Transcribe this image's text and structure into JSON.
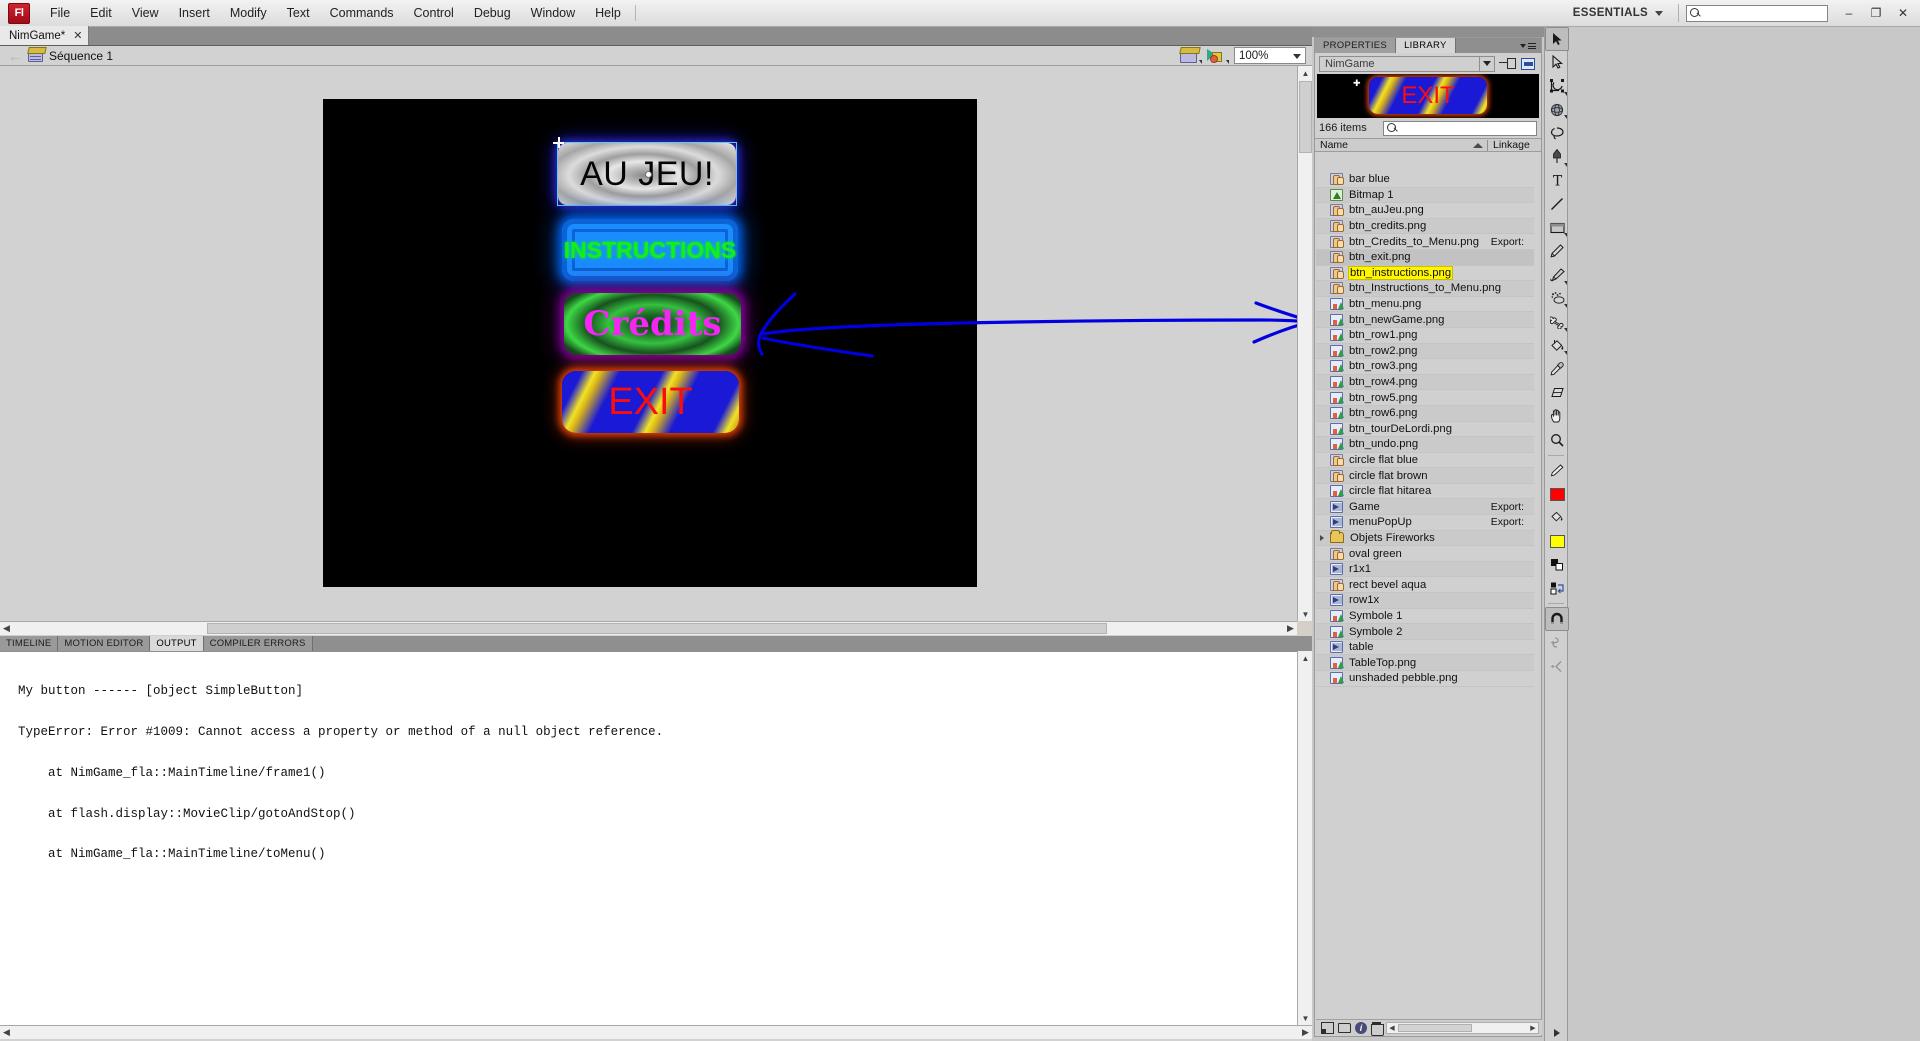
{
  "app": {
    "logo": "Fl",
    "menu": [
      "File",
      "Edit",
      "View",
      "Insert",
      "Modify",
      "Text",
      "Commands",
      "Control",
      "Debug",
      "Window",
      "Help"
    ],
    "workspace": "ESSENTIALS",
    "search_placeholder": "",
    "window_buttons": {
      "minimize": "–",
      "maximize": "❐",
      "close": "✕"
    }
  },
  "document_tab": {
    "title": "NimGame*",
    "close": "✕"
  },
  "edit_bar": {
    "back": "←",
    "scene_name": "Séquence 1",
    "zoom": "100%",
    "edit_scene_icon": "scene-icon",
    "edit_symbols_icon": "symbols-icon"
  },
  "stage": {
    "buttons": [
      {
        "label": "AU JEU!",
        "name": "btn-au-jeu",
        "selected": true
      },
      {
        "label": "INSTRUCTIONS",
        "name": "btn-instructions",
        "selected": false
      },
      {
        "label": "Crédits",
        "name": "btn-credits",
        "selected": false
      },
      {
        "label": "EXIT",
        "name": "btn-exit",
        "selected": false
      }
    ],
    "annotation": {
      "type": "hand-drawn-arrow",
      "color": "#0000e0"
    },
    "selection_color": "#66c8f2"
  },
  "bottom_panel": {
    "tabs": [
      {
        "label": "TIMELINE",
        "active": false
      },
      {
        "label": "MOTION EDITOR",
        "active": false
      },
      {
        "label": "OUTPUT",
        "active": true
      },
      {
        "label": "COMPILER ERRORS",
        "active": false
      }
    ],
    "output_lines": [
      "My button ------ [object SimpleButton]",
      "TypeError: Error #1009: Cannot access a property or method of a null object reference.",
      "    at NimGame_fla::MainTimeline/frame1()",
      "    at flash.display::MovieClip/gotoAndStop()",
      "    at NimGame_fla::MainTimeline/toMenu()"
    ]
  },
  "library": {
    "tabs": [
      {
        "label": "PROPERTIES",
        "active": false
      },
      {
        "label": "LIBRARY",
        "active": true
      }
    ],
    "menu_icon": "panel-menu-icon",
    "document_select": "NimGame",
    "pin_icon": "pin-library-icon",
    "new_library_icon": "new-library-panel-icon",
    "preview_label": "EXIT",
    "item_count": "166 items",
    "search_placeholder": "",
    "columns": {
      "name": "Name",
      "linkage": "Linkage"
    },
    "items": [
      {
        "name": "bar blue",
        "type": "button",
        "linkage": ""
      },
      {
        "name": "Bitmap 1",
        "type": "bitmap",
        "linkage": ""
      },
      {
        "name": "btn_auJeu.png",
        "type": "button",
        "linkage": ""
      },
      {
        "name": "btn_credits.png",
        "type": "button",
        "linkage": ""
      },
      {
        "name": "btn_Credits_to_Menu.png",
        "type": "button",
        "linkage": "Export:"
      },
      {
        "name": "btn_exit.png",
        "type": "button",
        "linkage": "",
        "selected": true
      },
      {
        "name": "btn_instructions.png",
        "type": "button",
        "linkage": "",
        "highlight": true
      },
      {
        "name": "btn_Instructions_to_Menu.png",
        "type": "button",
        "linkage": ""
      },
      {
        "name": "btn_menu.png",
        "type": "graphic",
        "linkage": ""
      },
      {
        "name": "btn_newGame.png",
        "type": "graphic",
        "linkage": ""
      },
      {
        "name": "btn_row1.png",
        "type": "graphic",
        "linkage": ""
      },
      {
        "name": "btn_row2.png",
        "type": "graphic",
        "linkage": ""
      },
      {
        "name": "btn_row3.png",
        "type": "graphic",
        "linkage": ""
      },
      {
        "name": "btn_row4.png",
        "type": "graphic",
        "linkage": ""
      },
      {
        "name": "btn_row5.png",
        "type": "graphic",
        "linkage": ""
      },
      {
        "name": "btn_row6.png",
        "type": "graphic",
        "linkage": ""
      },
      {
        "name": "btn_tourDeLordi.png",
        "type": "graphic",
        "linkage": ""
      },
      {
        "name": "btn_undo.png",
        "type": "graphic",
        "linkage": ""
      },
      {
        "name": "circle flat blue",
        "type": "button",
        "linkage": ""
      },
      {
        "name": "circle flat brown",
        "type": "button",
        "linkage": ""
      },
      {
        "name": "circle flat hitarea",
        "type": "graphic",
        "linkage": ""
      },
      {
        "name": "Game",
        "type": "movie",
        "linkage": "Export:"
      },
      {
        "name": "menuPopUp",
        "type": "movie",
        "linkage": "Export:"
      },
      {
        "name": "Objets Fireworks",
        "type": "folder",
        "linkage": ""
      },
      {
        "name": "oval green",
        "type": "button",
        "linkage": ""
      },
      {
        "name": "r1x1",
        "type": "movie",
        "linkage": ""
      },
      {
        "name": "rect bevel aqua",
        "type": "button",
        "linkage": ""
      },
      {
        "name": "row1x",
        "type": "movie",
        "linkage": ""
      },
      {
        "name": "Symbole 1",
        "type": "graphic",
        "linkage": ""
      },
      {
        "name": "Symbole 2",
        "type": "graphic",
        "linkage": ""
      },
      {
        "name": "table",
        "type": "movie",
        "linkage": ""
      },
      {
        "name": "TableTop.png",
        "type": "graphic",
        "linkage": ""
      },
      {
        "name": "unshaded pebble.png",
        "type": "graphic",
        "linkage": ""
      }
    ],
    "bottom_buttons": [
      "new-symbol-icon",
      "new-folder-icon",
      "properties-icon",
      "delete-icon"
    ]
  },
  "tools": {
    "items": [
      {
        "icon": "selection-tool-icon",
        "active": true,
        "sub": false,
        "dim": false
      },
      {
        "icon": "subselection-tool-icon",
        "active": false,
        "sub": false,
        "dim": false
      },
      {
        "icon": "free-transform-tool-icon",
        "active": false,
        "sub": true,
        "dim": false
      },
      {
        "icon": "3d-rotation-tool-icon",
        "active": false,
        "sub": true,
        "dim": false
      },
      {
        "icon": "lasso-tool-icon",
        "active": false,
        "sub": false,
        "dim": false
      },
      {
        "icon": "pen-tool-icon",
        "active": false,
        "sub": true,
        "dim": false
      },
      {
        "icon": "text-tool-icon",
        "active": false,
        "sub": false,
        "dim": false
      },
      {
        "icon": "line-tool-icon",
        "active": false,
        "sub": false,
        "dim": false
      },
      {
        "icon": "rectangle-tool-icon",
        "active": false,
        "sub": true,
        "dim": false
      },
      {
        "icon": "pencil-tool-icon",
        "active": false,
        "sub": false,
        "dim": false
      },
      {
        "icon": "brush-tool-icon",
        "active": false,
        "sub": true,
        "dim": false
      },
      {
        "icon": "spray-brush-tool-icon",
        "active": false,
        "sub": true,
        "dim": false
      },
      {
        "icon": "bone-tool-icon",
        "active": false,
        "sub": true,
        "dim": false
      },
      {
        "icon": "paint-bucket-tool-icon",
        "active": false,
        "sub": true,
        "dim": false
      },
      {
        "icon": "eyedropper-tool-icon",
        "active": false,
        "sub": false,
        "dim": false
      },
      {
        "icon": "eraser-tool-icon",
        "active": false,
        "sub": false,
        "dim": false
      },
      {
        "icon": "hand-tool-icon",
        "active": false,
        "sub": false,
        "dim": false
      },
      {
        "icon": "zoom-tool-icon",
        "active": false,
        "sub": false,
        "dim": false
      }
    ],
    "stroke_color": "#ff0000",
    "fill_color": "#ffff00",
    "options": [
      {
        "icon": "black-white-colors-icon"
      },
      {
        "icon": "swap-colors-icon"
      },
      {
        "icon": "snap-to-objects-icon",
        "active": true
      },
      {
        "icon": "smooth-icon",
        "dim": true
      },
      {
        "icon": "straighten-icon",
        "dim": true
      }
    ]
  }
}
